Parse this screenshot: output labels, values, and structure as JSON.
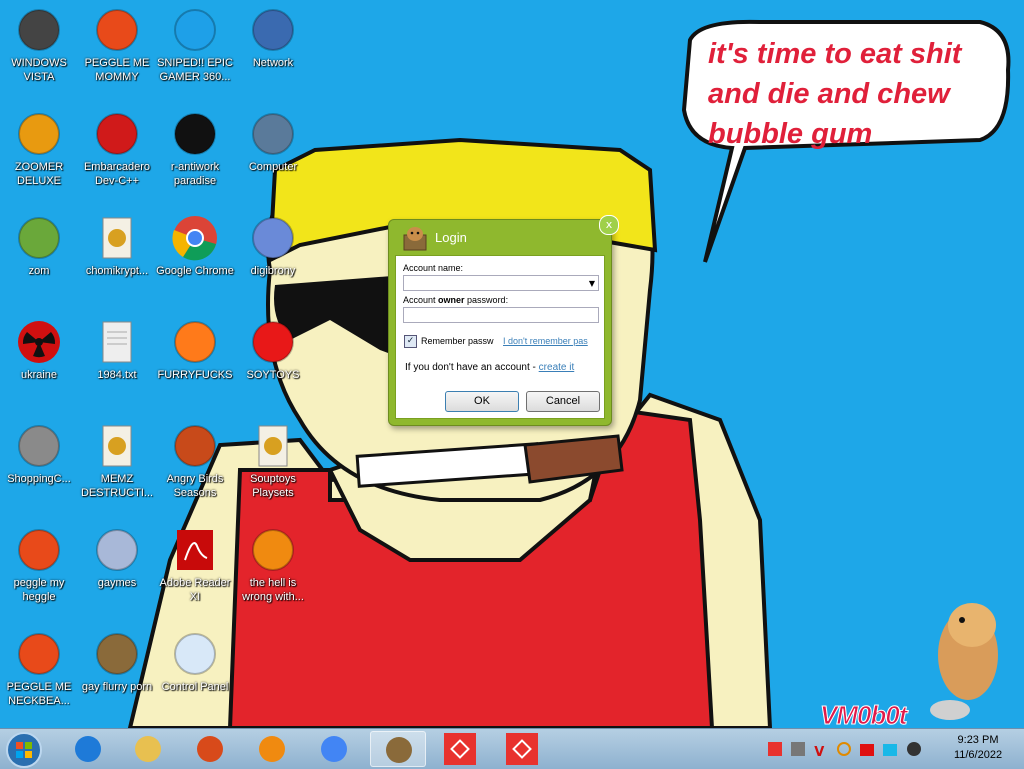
{
  "desktop": {
    "icons": [
      {
        "label": "WINDOWS VISTA",
        "icon": "bbq-grill-icon"
      },
      {
        "label": "PEGGLE ME MOMMY",
        "icon": "peggle-icon"
      },
      {
        "label": "SNIPED!! EPIC GAMER 360...",
        "icon": "skype-icon"
      },
      {
        "label": "Network",
        "icon": "network-icon"
      },
      {
        "label": "ZOOMER DELUXE",
        "icon": "zuma-icon"
      },
      {
        "label": "Embarcadero Dev-C++",
        "icon": "devcpp-icon"
      },
      {
        "label": "r-antiwork paradise",
        "icon": "antiwork-icon"
      },
      {
        "label": "Computer",
        "icon": "computer-icon"
      },
      {
        "label": "zom",
        "icon": "plant-icon"
      },
      {
        "label": "chomikrypt...",
        "icon": "shortcut-file-icon"
      },
      {
        "label": "Google Chrome",
        "icon": "chrome-icon"
      },
      {
        "label": "digibrony",
        "icon": "digibrony-icon"
      },
      {
        "label": "ukraine",
        "icon": "radiation-icon"
      },
      {
        "label": "1984.txt",
        "icon": "text-file-icon"
      },
      {
        "label": "FURRYFUCKS",
        "icon": "firefox-icon"
      },
      {
        "label": "SOYTOYS",
        "icon": "soytoys-icon"
      },
      {
        "label": "ShoppingC...",
        "icon": "flash-icon"
      },
      {
        "label": "MEMZ DESTRUCTI...",
        "icon": "shortcut-file-icon"
      },
      {
        "label": "Angry Birds Seasons",
        "icon": "angry-birds-icon"
      },
      {
        "label": "Souptoys Playsets",
        "icon": "shortcut-file-icon"
      },
      {
        "label": "peggle my heggle",
        "icon": "peggle-icon"
      },
      {
        "label": "gaymes",
        "icon": "games-folder-icon"
      },
      {
        "label": "Adobe Reader XI",
        "icon": "adobe-reader-icon"
      },
      {
        "label": "the hell is wrong with...",
        "icon": "uc-browser-icon"
      },
      {
        "label": "PEGGLE ME NECKBEA...",
        "icon": "peggle-icon"
      },
      {
        "label": "gay flurry porn",
        "icon": "bonzi-box-icon"
      },
      {
        "label": "Control Panel",
        "icon": "control-panel-icon"
      }
    ],
    "speech_bubble": "it's time to eat shit and die and chew bubble gum",
    "watermark": "VM0b0t"
  },
  "login": {
    "title": "Login",
    "close": "x",
    "account_name_label": "Account name:",
    "account_name_value": "",
    "password_label_prefix": "Account ",
    "password_label_bold": "owner",
    "password_label_suffix": " password:",
    "password_value": "",
    "remember_label": "Remember passw",
    "remember_checked": true,
    "forgot_link": "I don't remember pas",
    "no_account_text": "If you don't have an account - ",
    "create_link": "create it",
    "ok_label": "OK",
    "cancel_label": "Cancel"
  },
  "taskbar": {
    "buttons": [
      "internet-explorer-icon",
      "explorer-icon",
      "media-center-icon",
      "uc-browser-icon",
      "chrome-icon",
      "bonzi-box-icon",
      "anydesk-icon",
      "anydesk-icon"
    ],
    "active_index": 5,
    "clock_time": "9:23 PM",
    "clock_date": "11/6/2022"
  },
  "colors": {
    "desktop_bg": "#1ea7e8",
    "login_frame": "#8fb82e",
    "speech_text": "#e0203a"
  }
}
